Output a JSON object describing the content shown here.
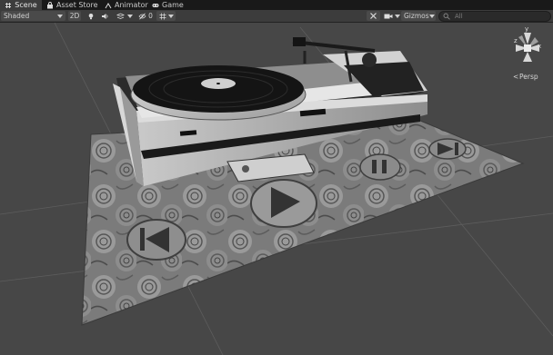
{
  "tabs": [
    {
      "label": "Scene",
      "icon": "scene-grid-icon",
      "active": true
    },
    {
      "label": "Asset Store",
      "icon": "asset-store-bag-icon"
    },
    {
      "label": "Animator",
      "icon": "animator-icon"
    },
    {
      "label": "Game",
      "icon": "gamepad-icon"
    }
  ],
  "toolbar": {
    "shading_mode": "Shaded",
    "mode_2d": "2D",
    "hidden_count": "0",
    "gizmos_label": "Gizmos",
    "search_placeholder": "All"
  },
  "view": {
    "projection_label": "Persp",
    "axes": {
      "y": "y",
      "x": "x",
      "z": "z"
    }
  },
  "colors": {
    "tab_bar_bg": "#191919",
    "toolbar_bg": "#3c3c3c",
    "scene_bg": "#474747"
  }
}
